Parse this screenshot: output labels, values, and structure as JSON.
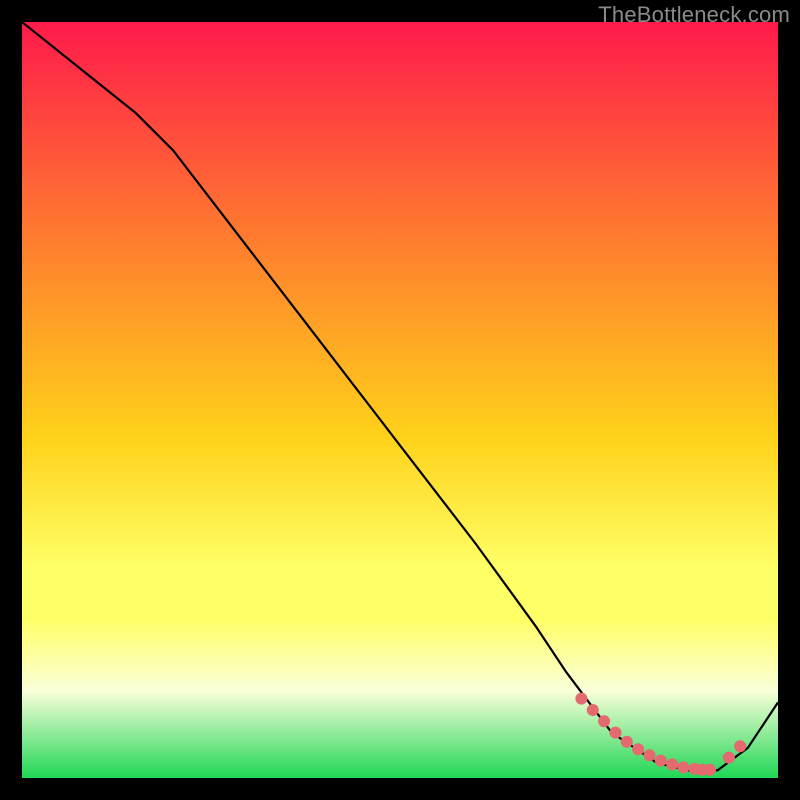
{
  "watermark": {
    "text": "TheBottleneck.com"
  },
  "colors": {
    "gradient_top": "#ff1a4b",
    "gradient_mid1": "#ff7a2f",
    "gradient_mid2": "#ffd21a",
    "gradient_mid3": "#ffff66",
    "gradient_band": "#f9ffd9",
    "gradient_bottom": "#1fd655",
    "line": "#000000",
    "marker": "#e46a6f"
  },
  "chart_data": {
    "type": "line",
    "title": "",
    "xlabel": "",
    "ylabel": "",
    "xlim": [
      0,
      100
    ],
    "ylim": [
      0,
      100
    ],
    "grid": false,
    "legend": null,
    "series": [
      {
        "name": "curve",
        "x": [
          0,
          15,
          20,
          30,
          40,
          50,
          60,
          68,
          72,
          78,
          84,
          88,
          92,
          96,
          100
        ],
        "y": [
          100,
          88,
          83,
          70,
          57,
          44,
          31,
          20,
          14,
          6,
          2,
          1,
          1,
          4,
          10
        ]
      }
    ],
    "markers": {
      "name": "highlight-points",
      "x": [
        74,
        75.5,
        77,
        78.5,
        80,
        81.5,
        83,
        84.5,
        86,
        87.5,
        89,
        90,
        91,
        93.5,
        95
      ],
      "y": [
        10.5,
        9,
        7.5,
        6,
        4.8,
        3.8,
        3,
        2.3,
        1.8,
        1.4,
        1.2,
        1.1,
        1.1,
        2.7,
        4.2
      ]
    }
  }
}
